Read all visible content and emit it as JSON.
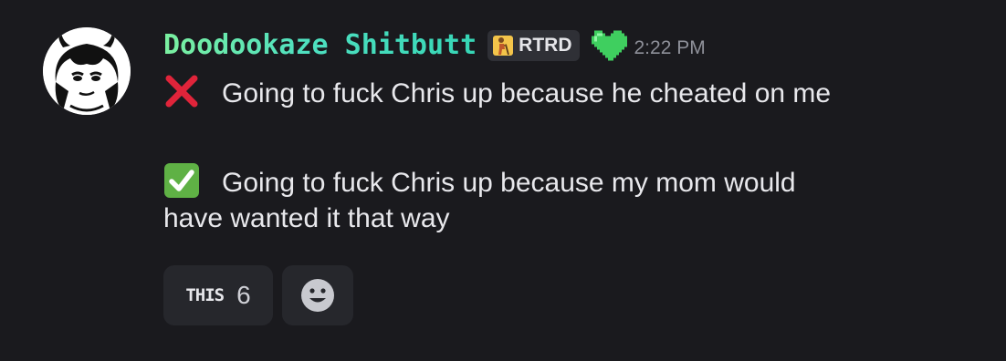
{
  "message": {
    "author": {
      "name": "Doodookaze Shitbutt",
      "role_tag": "RTRD",
      "name_colors": [
        "#7bf0a0",
        "#36d6b6"
      ],
      "avatar": "anime-girl-avatar",
      "role_icon": "person-with-cane-icon",
      "badge_icon": "green-pixel-heart-icon"
    },
    "timestamp": "2:22 PM",
    "lines": [
      {
        "emoji": "cross-mark-icon",
        "text": "Going to fuck Chris up because he cheated on me"
      },
      {
        "emoji": "check-mark-icon",
        "text": "Going to fuck Chris up because my mom would"
      },
      {
        "emoji": null,
        "text": "have wanted it that way"
      }
    ],
    "reactions": [
      {
        "emoji_text": "THIS",
        "count": "6"
      },
      {
        "emoji": "add-reaction-smiley-icon"
      }
    ]
  },
  "colors": {
    "background": "#1a1a1e",
    "text": "#e8e8ec",
    "timestamp": "#8e9099",
    "reaction_bg": "#26272c",
    "cross": "#e0243a",
    "check_bg": "#5fb145",
    "heart": "#3fcf5f"
  }
}
